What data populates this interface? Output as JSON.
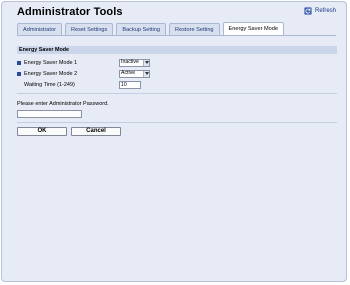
{
  "header": {
    "title": "Administrator Tools",
    "refresh_label": "Refresh"
  },
  "tabs": [
    {
      "label": "Administrator",
      "active": false
    },
    {
      "label": "Reset Settings",
      "active": false
    },
    {
      "label": "Backup Setting",
      "active": false
    },
    {
      "label": "Restore Setting",
      "active": false
    },
    {
      "label": "Energy Saver Mode",
      "active": true
    }
  ],
  "section": {
    "title": "Energy Saver Mode",
    "rows": [
      {
        "label": "Energy Saver Mode 1",
        "value": "Inactive"
      },
      {
        "label": "Energy Saver Mode 2",
        "value": "Active"
      },
      {
        "label": "Waiting Time (1-249)",
        "value": "10"
      }
    ]
  },
  "password": {
    "label": "Please enter Administrator Password.",
    "value": ""
  },
  "buttons": {
    "ok": "OK",
    "cancel": "Cancel"
  },
  "colors": {
    "background": "#e6ebf5",
    "section_header": "#ccd6ea",
    "accent": "#2c4a9c"
  }
}
